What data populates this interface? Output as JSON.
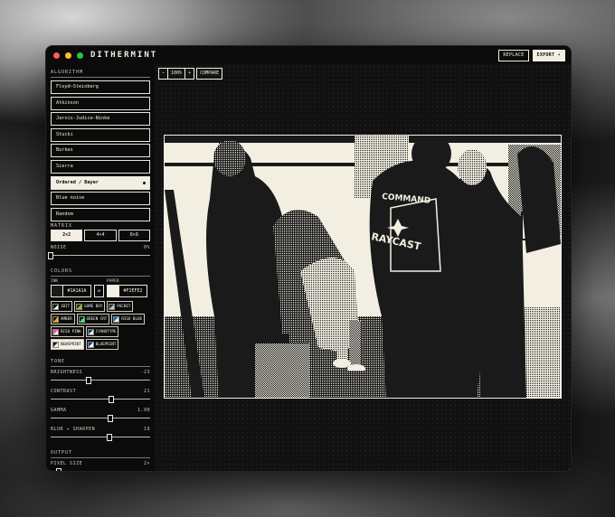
{
  "app": {
    "title": "DITHERMINT"
  },
  "toolbar": {
    "replace": "REPLACE",
    "export": "EXPORT ▾"
  },
  "zoom": {
    "minus": "−",
    "level": "100%",
    "plus": "+",
    "compare": "COMPARE"
  },
  "sections": {
    "algorithm": "ALGORITHM",
    "colors": "COLORS",
    "tone": "TONE",
    "output": "OUTPUT"
  },
  "algorithms": [
    {
      "label": "Floyd–Steinberg"
    },
    {
      "label": "Atkinson"
    },
    {
      "label": "Jarvis-Judice-Ninke"
    },
    {
      "label": "Stucki"
    },
    {
      "label": "Burkes"
    },
    {
      "label": "Sierra"
    },
    {
      "label": "Ordered / Bayer",
      "active": true
    },
    {
      "label": "Blue noise"
    },
    {
      "label": "Random"
    }
  ],
  "matrix": {
    "label": "MATRIX",
    "options": [
      "2×2",
      "4×4",
      "8×8"
    ],
    "selected": "2×2"
  },
  "noise": {
    "label": "NOISE",
    "value": "0%",
    "fraction": 0.0
  },
  "colors": {
    "ink": {
      "label": "INK",
      "hex": "#1A1A1A",
      "color": "#1a1a1a"
    },
    "paper": {
      "label": "PAPER",
      "hex": "#F2EFE2",
      "color": "#f2efe2"
    },
    "swap": "⇄",
    "presets": [
      {
        "label": "1BIT",
        "c1": "#000000",
        "c2": "#ffffff"
      },
      {
        "label": "GAME BOY",
        "c1": "#0f380f",
        "c2": "#9bbc0f"
      },
      {
        "label": "POCKET",
        "c1": "#2a2a2a",
        "c2": "#c4cfa1"
      },
      {
        "label": "AMBER",
        "c1": "#1a0f00",
        "c2": "#ffb000"
      },
      {
        "label": "GREEN CRT",
        "c1": "#001a00",
        "c2": "#33ff66"
      },
      {
        "label": "RISO BLUE",
        "c1": "#0078bf",
        "c2": "#f2efe2"
      },
      {
        "label": "RISO PINK",
        "c1": "#ff48b0",
        "c2": "#f2efe2"
      },
      {
        "label": "CYANOTYPE",
        "c1": "#0b3c6e",
        "c2": "#e8f0f7"
      },
      {
        "label": "NEWSPRINT",
        "c1": "#1a1a1a",
        "c2": "#f2efe2",
        "active": true
      },
      {
        "label": "BLUEPRINT",
        "c1": "#0a3d91",
        "c2": "#ffffff"
      }
    ]
  },
  "tone": {
    "brightness": {
      "label": "BRIGHTNESS",
      "value": "-23",
      "fraction": 0.385
    },
    "contrast": {
      "label": "CONTRAST",
      "value": "21",
      "fraction": 0.605
    },
    "gamma": {
      "label": "GAMMA",
      "value": "1.90",
      "fraction": 0.6
    },
    "blur": {
      "label": "BLUR ↔ SHARPEN",
      "value": "19",
      "fraction": 0.595
    }
  },
  "output": {
    "pixel_size": {
      "label": "PIXEL SIZE",
      "value": "2×",
      "fraction": 0.08
    }
  },
  "preview": {
    "text1": "COMMAND",
    "text2": "RAYCAST"
  }
}
